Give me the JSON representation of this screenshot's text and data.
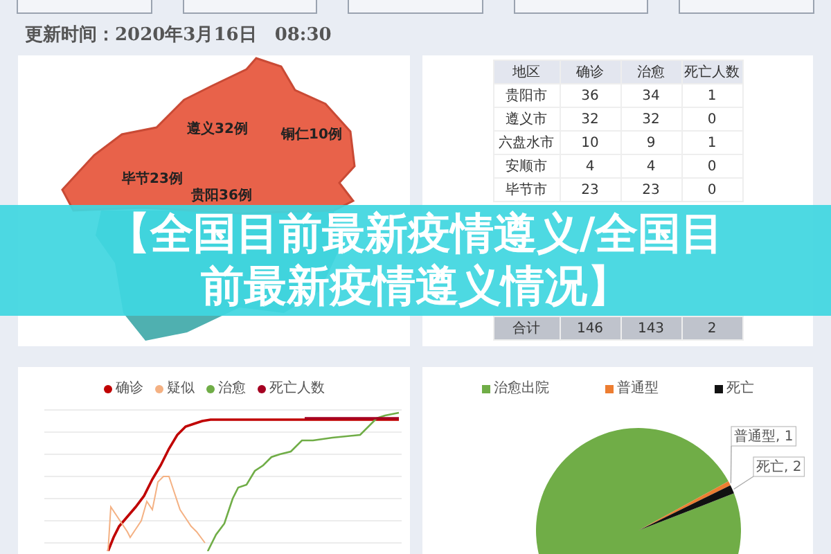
{
  "update_time": "更新时间：2020年3月16日　08:30",
  "map": {
    "labels": [
      {
        "text": "遵义32例",
        "kind": "north"
      },
      {
        "text": "铜仁10例",
        "kind": "north"
      },
      {
        "text": "毕节23例",
        "kind": "north"
      },
      {
        "text": "贵阳36例",
        "kind": "north"
      }
    ]
  },
  "table": {
    "columns": [
      "地区",
      "确诊",
      "治愈",
      "死亡人数"
    ],
    "rows": [
      [
        "贵阳市",
        "36",
        "34",
        "1"
      ],
      [
        "遵义市",
        "32",
        "32",
        "0"
      ],
      [
        "六盘水市",
        "10",
        "9",
        "1"
      ],
      [
        "安顺市",
        "4",
        "4",
        "0"
      ],
      [
        "毕节市",
        "23",
        "23",
        "0"
      ]
    ],
    "total": [
      "合计",
      "146",
      "143",
      "2"
    ]
  },
  "line_chart": {
    "legend": [
      {
        "name": "确诊",
        "color": "#c00000"
      },
      {
        "name": "疑似",
        "color": "#f4b183"
      },
      {
        "name": "治愈",
        "color": "#70ad47"
      },
      {
        "name": "死亡人数",
        "color": "#a50021"
      }
    ]
  },
  "pie_chart": {
    "chart_data": {
      "type": "pie",
      "categories": [
        "治愈出院",
        "普通型",
        "死亡"
      ],
      "values": [
        143,
        1,
        2
      ],
      "colors": [
        "#70ad47",
        "#ed7d31",
        "#111111"
      ],
      "value_labels": [
        null,
        "普通型, 1",
        "死亡, 2"
      ]
    }
  },
  "banner": {
    "text": "【全国目前最新疫情遵义/全国目前最新疫情遵义情况】"
  }
}
